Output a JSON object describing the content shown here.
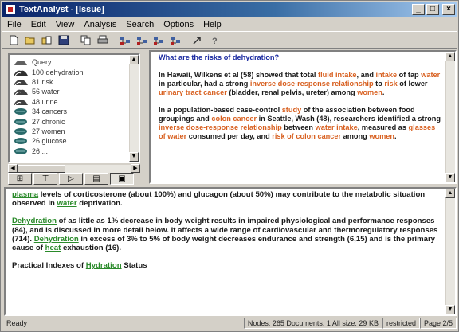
{
  "window": {
    "title": "TextAnalyst - [Issue]"
  },
  "titlebar_buttons": [
    {
      "name": "minimize-button",
      "glyph": "_"
    },
    {
      "name": "maximize-button",
      "glyph": "□"
    },
    {
      "name": "close-button",
      "glyph": "×"
    }
  ],
  "menu": [
    "File",
    "Edit",
    "View",
    "Analysis",
    "Search",
    "Options",
    "Help"
  ],
  "toolbar": [
    {
      "name": "new-doc-icon"
    },
    {
      "name": "open-folder-icon"
    },
    {
      "name": "open-file-icon"
    },
    {
      "name": "save-icon"
    },
    {
      "name": "sep"
    },
    {
      "name": "copy-icon"
    },
    {
      "name": "print-icon"
    },
    {
      "name": "sep"
    },
    {
      "name": "network-icon-1"
    },
    {
      "name": "network-icon-2"
    },
    {
      "name": "network-icon-3"
    },
    {
      "name": "network-icon-4"
    },
    {
      "name": "sep"
    },
    {
      "name": "arrow-icon"
    },
    {
      "name": "help-icon"
    }
  ],
  "tree": {
    "items": [
      {
        "label": "Query",
        "icon": "query",
        "color": "#606060"
      },
      {
        "label": "100 dehydration",
        "icon": "wave",
        "color": "#303030"
      },
      {
        "label": "81 risk",
        "icon": "wave",
        "color": "#404040"
      },
      {
        "label": "56 water",
        "icon": "wave",
        "color": "#404040"
      },
      {
        "label": "48 urine",
        "icon": "wave",
        "color": "#404040"
      },
      {
        "label": "34 cancers",
        "icon": "leaf",
        "color": "#2a6a6a"
      },
      {
        "label": "27 chronic",
        "icon": "leaf",
        "color": "#2a6a6a"
      },
      {
        "label": "27 women",
        "icon": "leaf",
        "color": "#2a6a6a"
      },
      {
        "label": "26 glucose",
        "icon": "leaf",
        "color": "#2a6a6a"
      },
      {
        "label": "26 ...",
        "icon": "leaf",
        "color": "#2a6a6a"
      }
    ],
    "tabs": [
      {
        "name": "tab-semantic-network",
        "glyph": "⊞"
      },
      {
        "name": "tab-topic-structure",
        "glyph": "⊤"
      },
      {
        "name": "tab-summary",
        "glyph": "▷"
      },
      {
        "name": "tab-query",
        "glyph": "▤"
      },
      {
        "name": "tab-results",
        "glyph": "▣"
      }
    ]
  },
  "question": {
    "title": "What are the risks of dehydration?",
    "paragraphs": [
      [
        {
          "t": "In Hawaii, Wilkens et al (58) showed that total "
        },
        {
          "t": "fluid intake",
          "h": true
        },
        {
          "t": ", and "
        },
        {
          "t": "intake",
          "h": true
        },
        {
          "t": " of tap "
        },
        {
          "t": "water",
          "h": true
        },
        {
          "t": " in particular, had a strong "
        },
        {
          "t": "inverse dose-response relationship",
          "h": true
        },
        {
          "t": " to "
        },
        {
          "t": "risk",
          "h": true
        },
        {
          "t": " of lower "
        },
        {
          "t": "urinary tract cancer",
          "h": true
        },
        {
          "t": " (bladder, renal pelvis, ureter) among "
        },
        {
          "t": "women",
          "h": true
        },
        {
          "t": "."
        }
      ],
      [
        {
          "t": " In a population-based case-control "
        },
        {
          "t": "study",
          "h": true
        },
        {
          "t": " of the association between food groupings and "
        },
        {
          "t": "colon cancer",
          "h": true
        },
        {
          "t": " in Seattle, Wash (48), researchers identified a strong "
        },
        {
          "t": "inverse dose-response relationship",
          "h": true
        },
        {
          "t": " between "
        },
        {
          "t": "water intake",
          "h": true
        },
        {
          "t": ", measured as "
        },
        {
          "t": "glasses of water",
          "h": true
        },
        {
          "t": " consumed per day, and "
        },
        {
          "t": "risk of colon cancer",
          "h": true
        },
        {
          "t": " among "
        },
        {
          "t": "women",
          "h": true
        },
        {
          "t": "."
        }
      ]
    ]
  },
  "document": {
    "paragraphs": [
      [
        {
          "t": "plasma",
          "l": true
        },
        {
          "t": " levels of corticosterone (about 100%) and glucagon (about 50%) may contribute to the metabolic situation observed in "
        },
        {
          "t": "water",
          "l": true
        },
        {
          "t": " deprivation."
        }
      ],
      [
        {
          "t": "Dehydration",
          "l": true
        },
        {
          "t": " of as little as 1% decrease in body weight results in impaired physiological and performance responses (84), and is discussed in more detail below. It affects a wide range of cardiovascular and thermoregulatory responses (714). "
        },
        {
          "t": "Dehydration",
          "l": true
        },
        {
          "t": " in excess of 3% to 5% of body weight decreases endurance and strength (6,15) and is the primary cause of "
        },
        {
          "t": "heat",
          "l": true
        },
        {
          "t": " exhaustion (16)."
        }
      ],
      [
        {
          "t": "Practical Indexes of "
        },
        {
          "t": "Hydration",
          "l": true
        },
        {
          "t": " Status"
        }
      ]
    ]
  },
  "status": {
    "ready": "Ready",
    "counts": "Nodes: 265 Documents: 1  All size: 29 KB",
    "mode": "restricted",
    "page": "Page 2/5"
  }
}
